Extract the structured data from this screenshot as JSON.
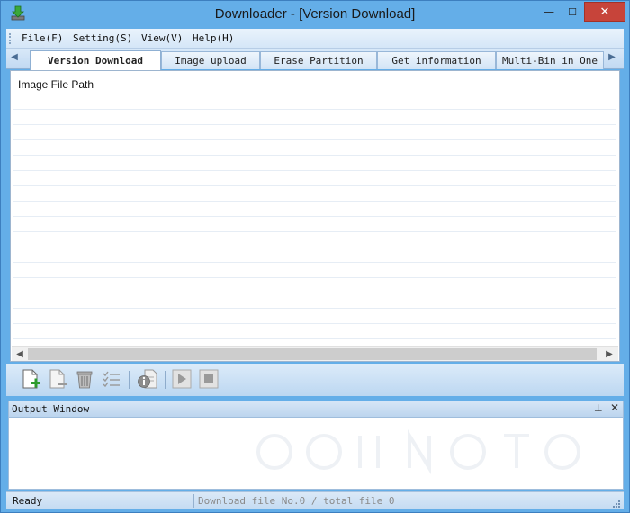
{
  "window": {
    "title": "Downloader - [Version Download]",
    "min_glyph": "—",
    "max_glyph": "☐",
    "close_glyph": "✕"
  },
  "menu": {
    "items": [
      {
        "label": "File(F)"
      },
      {
        "label": "Setting(S)"
      },
      {
        "label": "View(V)"
      },
      {
        "label": "Help(H)"
      }
    ]
  },
  "tabs": {
    "scroll_left": "◀",
    "scroll_right": "▶",
    "items": [
      {
        "label": "Version Download",
        "active": true
      },
      {
        "label": "Image upload",
        "active": false
      },
      {
        "label": "Erase Partition",
        "active": false
      },
      {
        "label": "Get information",
        "active": false
      },
      {
        "label": "Multi-Bin in One",
        "active": false
      }
    ]
  },
  "list": {
    "column_header": "Image File Path",
    "scroll_left": "◀",
    "scroll_right": "▶"
  },
  "toolbar": {
    "icons": [
      "add-file-icon",
      "remove-file-icon",
      "delete-icon",
      "checklist-icon",
      "info-icon",
      "play-icon",
      "stop-icon"
    ]
  },
  "output": {
    "title": "Output Window",
    "pin_glyph": "⊥",
    "close_glyph": "✕"
  },
  "status": {
    "ready": "Ready",
    "info": "Download file No.0 / total file 0"
  },
  "colors": {
    "frame": "#64aee8",
    "close_button": "#c7443a",
    "accent_green": "#2e9b2e"
  }
}
